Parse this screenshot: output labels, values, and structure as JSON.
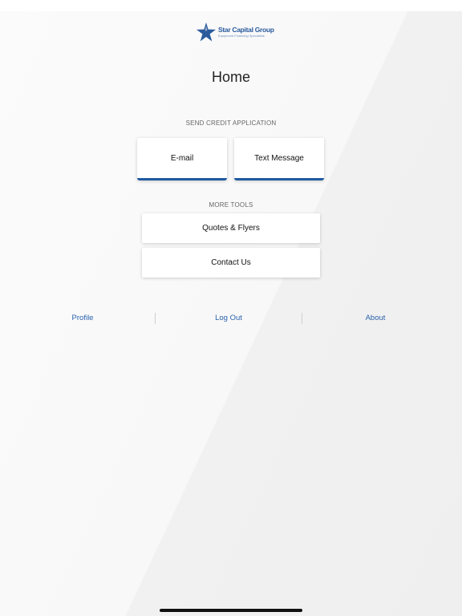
{
  "brand": {
    "name": "Star Capital Group",
    "tagline": "Equipment Financing Specialists",
    "icon": "star-icon",
    "color": "#2a5b9d"
  },
  "page": {
    "title": "Home"
  },
  "send_section": {
    "label": "SEND CREDIT APPLICATION",
    "email_label": "E-mail",
    "text_label": "Text Message",
    "accent_color": "#1e5aa0"
  },
  "tools_section": {
    "label": "MORE TOOLS",
    "quotes_label": "Quotes & Flyers",
    "contact_label": "Contact Us"
  },
  "footer": {
    "profile_label": "Profile",
    "logout_label": "Log Out",
    "about_label": "About",
    "link_color": "#2a62ad"
  }
}
